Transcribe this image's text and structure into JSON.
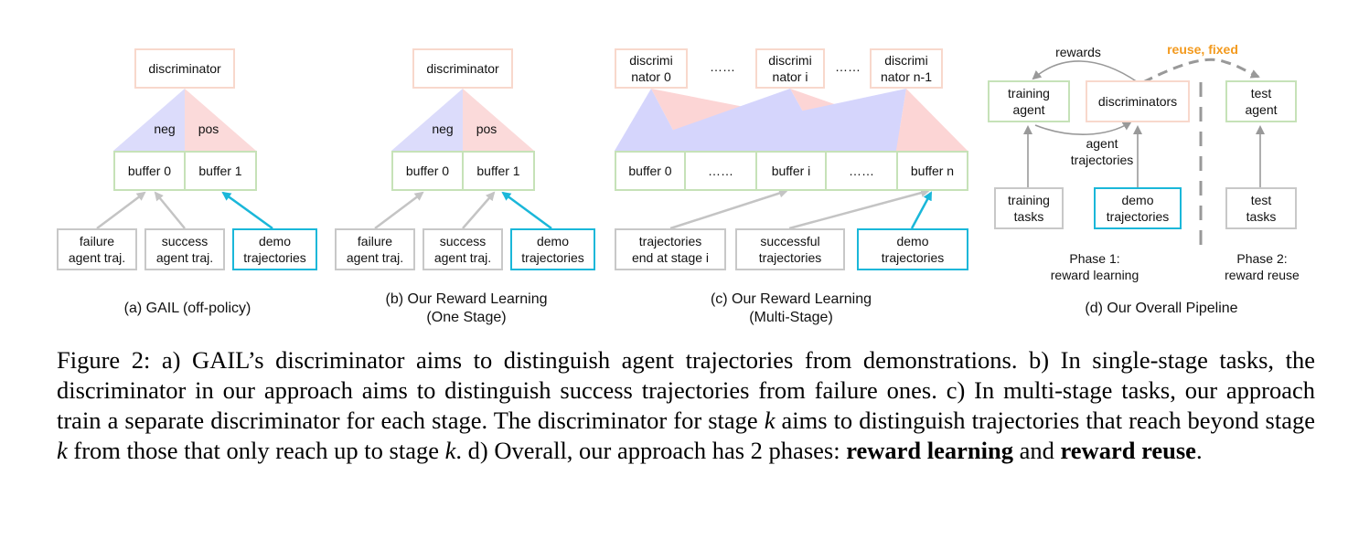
{
  "figure": {
    "panel_a": {
      "discriminator": "discriminator",
      "neg": "neg",
      "pos": "pos",
      "buffers": [
        "buffer 0",
        "buffer 1"
      ],
      "sources": [
        "failure\nagent traj.",
        "success\nagent traj.",
        "demo\ntrajectories"
      ],
      "caption": "(a) GAIL (off-policy)"
    },
    "panel_b": {
      "discriminator": "discriminator",
      "neg": "neg",
      "pos": "pos",
      "buffers": [
        "buffer 0",
        "buffer 1"
      ],
      "sources": [
        "failure\nagent traj.",
        "success\nagent traj.",
        "demo\ntrajectories"
      ],
      "caption": "(b) Our Reward Learning\n(One Stage)"
    },
    "panel_c": {
      "discriminators": [
        "discrimi\nnator 0",
        "discrimi\nnator i",
        "discrimi\nnator n-1"
      ],
      "ellipsis": "……",
      "buffers": [
        "buffer 0",
        "……",
        "buffer i",
        "……",
        "buffer n"
      ],
      "sources": [
        "trajectories\nend at stage i",
        "successful\ntrajectories",
        "demo\ntrajectories"
      ],
      "caption": "(c) Our Reward Learning\n(Multi-Stage)"
    },
    "panel_d": {
      "rewards": "rewards",
      "reuse_fixed": "reuse, fixed",
      "training_agent": "training\nagent",
      "discriminators": "discriminators",
      "test_agent": "test\nagent",
      "agent_trajectories": "agent\ntrajectories",
      "training_tasks": "training\ntasks",
      "demo_trajectories": "demo\ntrajectories",
      "test_tasks": "test\ntasks",
      "phase1": "Phase 1:\nreward learning",
      "phase2": "Phase 2:\nreward reuse",
      "caption": "(d) Our Overall Pipeline"
    },
    "colors": {
      "discriminator_border": "#f8d8cc",
      "buffer_border": "#c6e2b8",
      "source_border": "#c8c8c8",
      "demo_border": "#1ab7d9",
      "neg_fill": "#dcdcfb",
      "pos_fill": "#fbdada",
      "reuse_text": "#f39a1e"
    }
  },
  "caption": {
    "p1": "Figure 2: a) GAIL’s discriminator aims to distinguish agent trajectories from demonstrations. b) In single-stage tasks, the discriminator in our approach aims to distinguish success trajectories from failure ones. c) In multi-stage tasks, our approach train a separate discriminator for each stage. The discriminator for stage ",
    "k1": "k",
    "p2": " aims to distinguish trajectories that reach beyond stage ",
    "k2": "k",
    "p3": " from those that only reach up to stage ",
    "k3": "k",
    "p4": ". d) Overall, our approach has 2 phases: ",
    "b1": "reward learning",
    "p5": " and ",
    "b2": "reward reuse",
    "p6": "."
  }
}
